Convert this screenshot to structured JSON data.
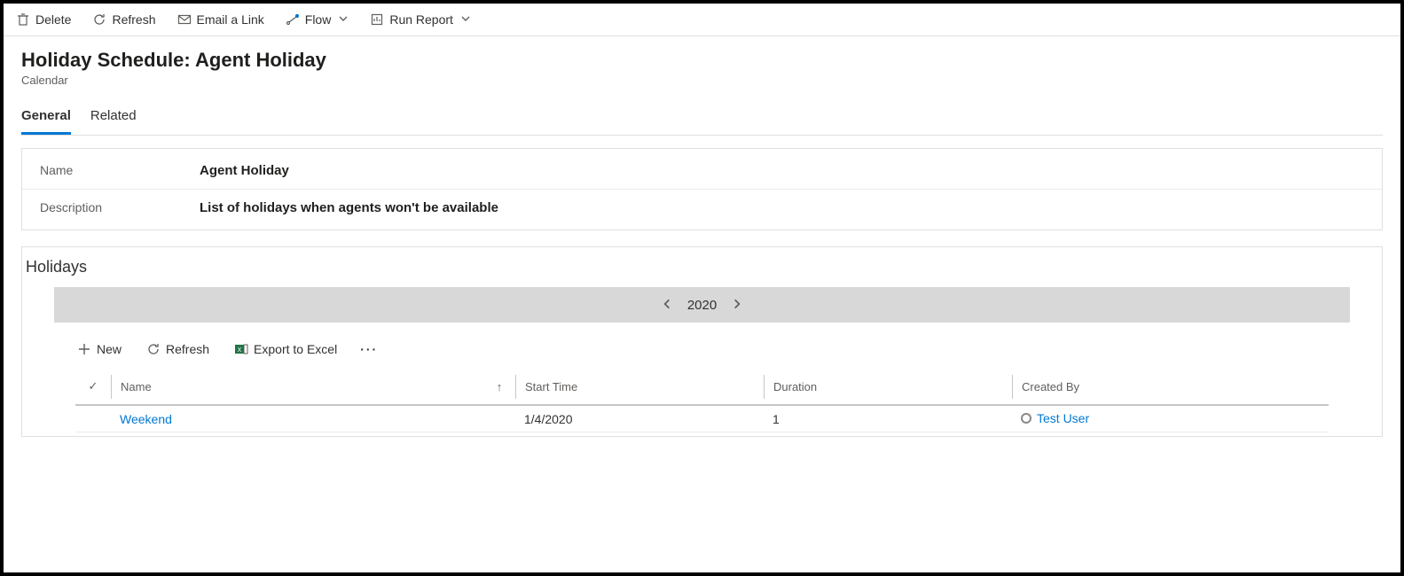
{
  "toolbar": {
    "delete": "Delete",
    "refresh": "Refresh",
    "email_link": "Email a Link",
    "flow": "Flow",
    "run_report": "Run Report"
  },
  "header": {
    "title": "Holiday Schedule: Agent Holiday",
    "subtitle": "Calendar"
  },
  "tabs": {
    "general": "General",
    "related": "Related"
  },
  "fields": {
    "name_label": "Name",
    "name_value": "Agent Holiday",
    "desc_label": "Description",
    "desc_value": "List of holidays when agents won't be available"
  },
  "holidays_section": {
    "title": "Holidays",
    "year": "2020",
    "grid_toolbar": {
      "new": "New",
      "refresh": "Refresh",
      "export": "Export to Excel"
    },
    "columns": {
      "name": "Name",
      "start": "Start Time",
      "duration": "Duration",
      "created_by": "Created By"
    },
    "rows": [
      {
        "name": "Weekend",
        "start": "1/4/2020",
        "duration": "1",
        "created_by": "Test User"
      }
    ]
  }
}
